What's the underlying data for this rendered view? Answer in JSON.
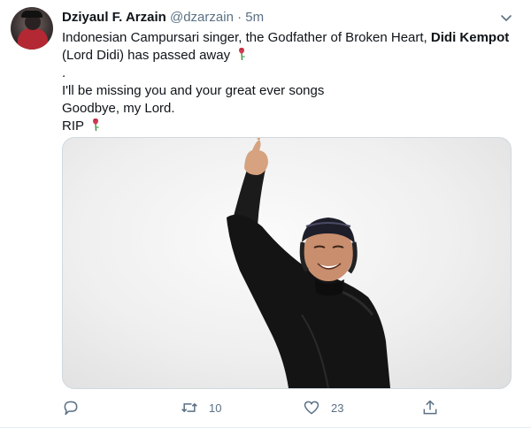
{
  "tweet": {
    "author_name": "Dziyaul F. Arzain",
    "author_handle": "@dzarzain",
    "separator": "·",
    "timestamp": "5m",
    "text_line1_before": "Indonesian Campursari singer, the Godfather of Broken Heart, ",
    "text_line1_bold": "Didi Kempot",
    "text_line2": "(Lord Didi) has passed away",
    "text_line3": ".",
    "text_line4": "I'll be missing you and your great ever songs",
    "text_line5": "Goodbye, my Lord.",
    "text_line6": "RIP",
    "emoji": "wilted-rose-icon"
  },
  "actions": {
    "reply_icon": "reply-icon",
    "reply_count": "",
    "retweet_icon": "retweet-icon",
    "retweet_count": "10",
    "like_icon": "heart-icon",
    "like_count": "23",
    "share_icon": "share-icon"
  },
  "colors": {
    "text": "#0f1419",
    "secondary": "#5b7083",
    "border": "#cfd9de"
  }
}
